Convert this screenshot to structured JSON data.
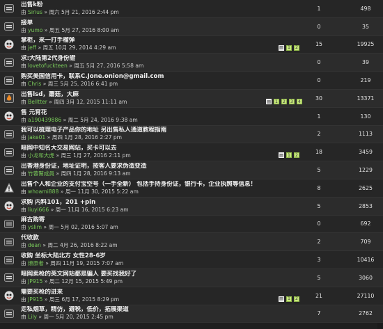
{
  "by_label": "由",
  "sep": "»",
  "rows": [
    {
      "title": "出售k粉",
      "author": "Sirius",
      "date": "周六 5月 21, 2016 2:44 pm",
      "replies": "1",
      "views": "498",
      "icon": "topic-icon",
      "pages": []
    },
    {
      "title": "接单",
      "author": "yumo",
      "date": "周五 5月 27, 2016 8:00 am",
      "replies": "0",
      "views": "35",
      "icon": "topic-icon",
      "pages": []
    },
    {
      "title": "掌柜，来一打手榴弹",
      "author": "jeff",
      "date": "周五 10月 29, 2014 4:29 am",
      "replies": "15",
      "views": "19925",
      "icon": "avatar-icon",
      "pages": [
        "1",
        "2"
      ]
    },
    {
      "title": "求:大陆第2代身份證",
      "author": "lovetofuckteen",
      "date": "周五 5月 27, 2016 5:58 am",
      "replies": "0",
      "views": "39",
      "icon": "topic-icon",
      "pages": []
    },
    {
      "title": "购买美国信用卡，联系C.Jone.onion@gmail.com",
      "author": "Chris",
      "date": "周三 5月 25, 2016 6:41 pm",
      "replies": "0",
      "views": "219",
      "icon": "topic-icon",
      "pages": []
    },
    {
      "title": "出售lsd，蘑菇，大麻",
      "author": "Belltter",
      "date": "周四 3月 12, 2015 11:11 am",
      "replies": "30",
      "views": "13371",
      "icon": "hot-topic-icon",
      "pages": [
        "1",
        "2",
        "3",
        "4"
      ]
    },
    {
      "title": "售 元宵花",
      "author": "a190439886",
      "date": "周二 5月 24, 2016 9:38 am",
      "replies": "1",
      "views": "130",
      "icon": "avatar-icon",
      "pages": []
    },
    {
      "title": "我可以梳理电子产品你的地址 另出售私人通道教程指南",
      "author": "jake01",
      "date": "周四 1月 28, 2016 2:27 pm",
      "replies": "2",
      "views": "1113",
      "icon": "topic-icon",
      "pages": []
    },
    {
      "title": "暗网中知名大交易网站，买卡可以去",
      "author": "小龙和大虎",
      "date": "周三 1月 27, 2016 2:11 pm",
      "replies": "18",
      "views": "3459",
      "icon": "topic-icon",
      "pages": [
        "1",
        "2"
      ]
    },
    {
      "title": "出香港身份证，地址证明，按客人要求伪造变造",
      "author": "竹蓉幫成員",
      "date": "周四 1月 28, 2016 9:13 am",
      "replies": "5",
      "views": "1229",
      "icon": "topic-icon",
      "pages": []
    },
    {
      "title": "出售个人和企业的支付宝空号（一手全新） 包括手持身份证，银行卡，企业执照等信息！",
      "author": "whoami888",
      "date": "周一 11月 30, 2015 5:22 am",
      "replies": "8",
      "views": "2625",
      "icon": "alert-icon",
      "pages": []
    },
    {
      "title": "求购 内料101，201 +pin",
      "author": "liuyi666",
      "date": "周一 11月 16, 2015 6:23 am",
      "replies": "5",
      "views": "2853",
      "icon": "avatar-icon",
      "pages": []
    },
    {
      "title": "麻古购寄",
      "author": "yslim",
      "date": "周一 5月 02, 2016 5:07 am",
      "replies": "0",
      "views": "692",
      "icon": "topic-icon",
      "pages": []
    },
    {
      "title": "代收款",
      "author": "dean",
      "date": "周二 4月 26, 2016 8:22 am",
      "replies": "2",
      "views": "709",
      "icon": "topic-icon",
      "pages": []
    },
    {
      "title": "收购 坐标大陆北方 女性28-6岁",
      "author": "燎原者",
      "date": "周四 11月 19, 2015 7:07 am",
      "replies": "3",
      "views": "10416",
      "icon": "topic-icon",
      "pages": []
    },
    {
      "title": "暗网卖枪的英文网站都是骗人 要买找我好了",
      "author": "JP915",
      "date": "周二 12月 15, 2015 5:49 pm",
      "replies": "5",
      "views": "3060",
      "icon": "topic-icon",
      "pages": []
    },
    {
      "title": "需要买枪的进来",
      "author": "JP915",
      "date": "周三 6月 17, 2015 8:29 pm",
      "replies": "21",
      "views": "27110",
      "icon": "avatar-icon",
      "pages": [
        "1",
        "2"
      ]
    },
    {
      "title": "走私烟草，精仿，避税，低价，拓展渠道",
      "author": "Lily",
      "date": "周一 5月 20, 2015 2:45 pm",
      "replies": "7",
      "views": "2762",
      "icon": "topic-icon",
      "pages": []
    }
  ]
}
